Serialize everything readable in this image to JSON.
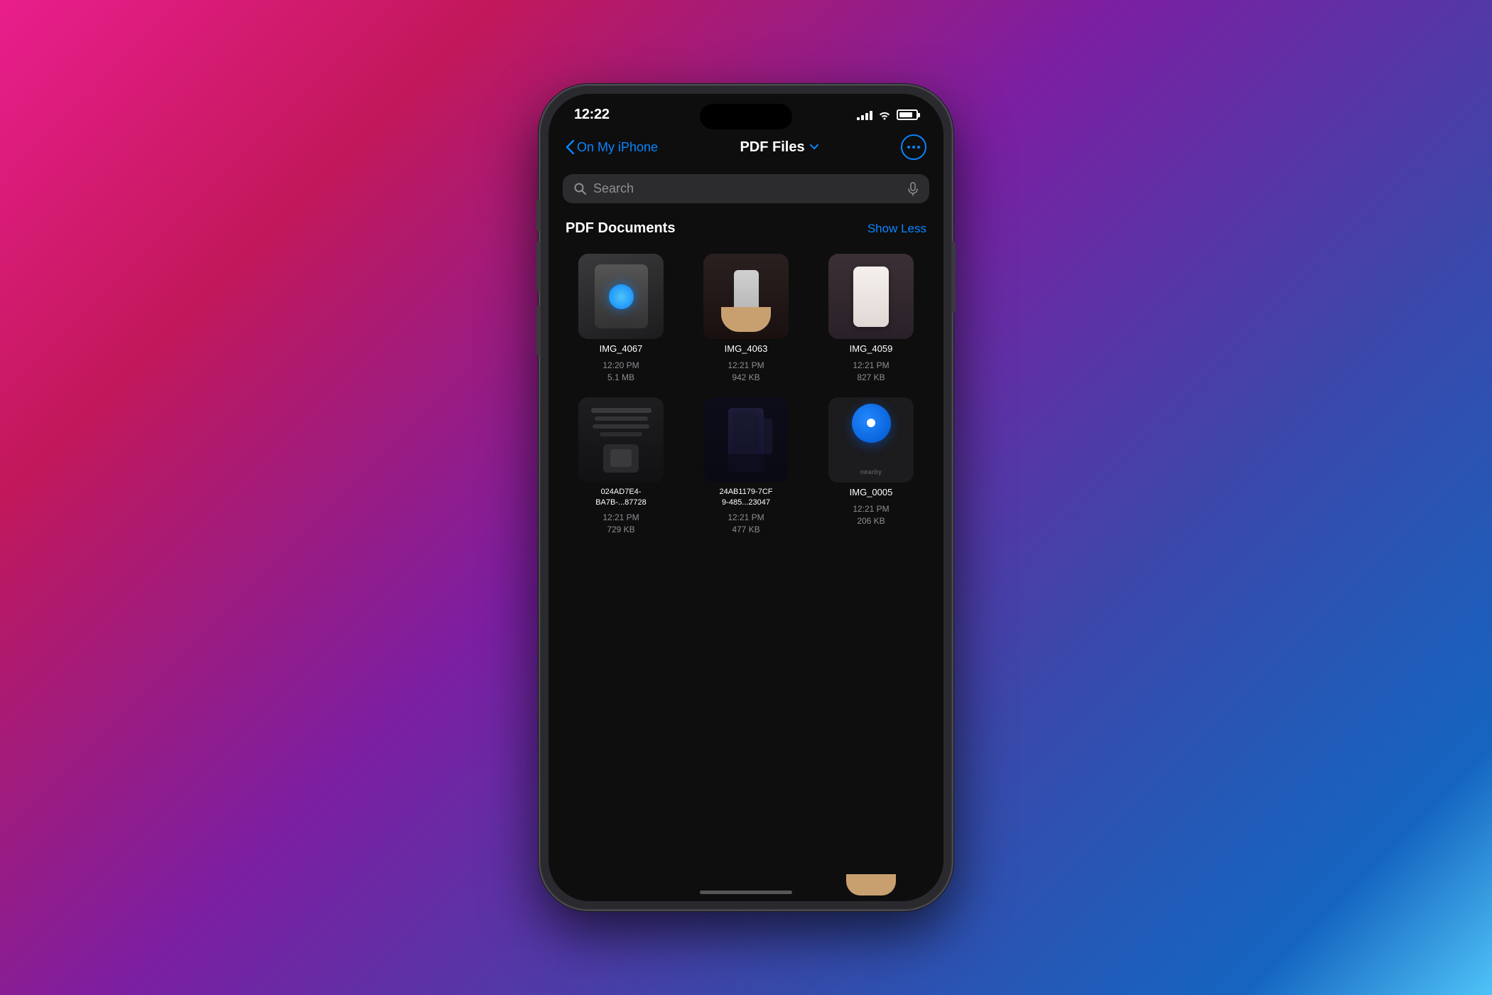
{
  "background": {
    "gradient": "magenta to blue-purple"
  },
  "statusBar": {
    "time": "12:22",
    "signal": "4 bars",
    "wifi": "connected",
    "battery": "80%"
  },
  "navigation": {
    "backLabel": "On My iPhone",
    "title": "PDF Files",
    "moreButton": "···"
  },
  "search": {
    "placeholder": "Search",
    "micLabel": "microphone"
  },
  "section": {
    "title": "PDF Documents",
    "showLessLabel": "Show Less"
  },
  "files": [
    {
      "name": "IMG_4067",
      "time": "12:20 PM",
      "size": "5.1 MB",
      "thumb": "tablet-blue-circle"
    },
    {
      "name": "IMG_4063",
      "time": "12:21 PM",
      "size": "942 KB",
      "thumb": "hand-white-device"
    },
    {
      "name": "IMG_4059",
      "time": "12:21 PM",
      "size": "827 KB",
      "thumb": "hand-beige-device"
    },
    {
      "name": "024AD7E4-\nBA7B-...87728",
      "name_line1": "024AD7E4-",
      "name_line2": "BA7B-...87728",
      "time": "12:21 PM",
      "size": "729 KB",
      "thumb": "dark-text"
    },
    {
      "name": "24AB1179-7CF\n9-485...23047",
      "name_line1": "24AB1179-7CF",
      "name_line2": "9-485...23047",
      "time": "12:21 PM",
      "size": "477 KB",
      "thumb": "dark-chair"
    },
    {
      "name": "IMG_0005",
      "time": "12:21 PM",
      "size": "206 KB",
      "thumb": "airtag-nearby"
    }
  ]
}
